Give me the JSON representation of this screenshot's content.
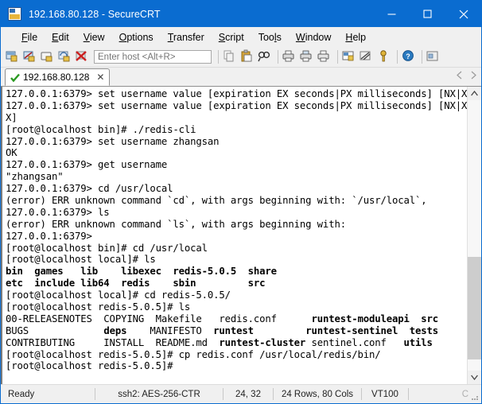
{
  "window": {
    "title": "192.168.80.128 - SecureCRT",
    "app_icon": "terminal-window-icon",
    "minimize_label": "Minimize",
    "maximize_label": "Maximize",
    "close_label": "Close",
    "accent_color": "#0a6cd0",
    "titlebar_text_color": "#ffffff"
  },
  "menubar": {
    "items": [
      {
        "label": "File",
        "mnemonic": "F"
      },
      {
        "label": "Edit",
        "mnemonic": "E"
      },
      {
        "label": "View",
        "mnemonic": "V"
      },
      {
        "label": "Options",
        "mnemonic": "O"
      },
      {
        "label": "Transfer",
        "mnemonic": "T"
      },
      {
        "label": "Script",
        "mnemonic": "S"
      },
      {
        "label": "Tools",
        "mnemonic": "l"
      },
      {
        "label": "Window",
        "mnemonic": "W"
      },
      {
        "label": "Help",
        "mnemonic": "H"
      }
    ]
  },
  "toolbar": {
    "host_placeholder": "Enter host <Alt+R>",
    "host_value": "",
    "icons_left": [
      "new-session-icon",
      "connect-sftp-icon",
      "connect-folder-icon",
      "reconnect-icon",
      "disconnect-icon"
    ],
    "icons_right": [
      "copy-icon",
      "paste-icon",
      "find-icon",
      "print-icon",
      "print-selection-icon",
      "print-screen-icon",
      "session-options-icon",
      "session-settings-icon",
      "key-icon",
      "help-icon",
      "arrange-icon"
    ]
  },
  "tabs": {
    "items": [
      {
        "label": "192.168.80.128",
        "status_icon": "green-check-icon",
        "close_icon": "close-icon",
        "active": true
      }
    ],
    "nav_prev_icon": "nav-prev-icon",
    "nav_next_icon": "nav-next-icon"
  },
  "terminal": {
    "foreground": "#000000",
    "background": "#ffffff",
    "lines": [
      [
        {
          "t": "127.0.0.1:6379> set username value [expiration EX seconds|PX milliseconds] [NX|X",
          "b": false
        }
      ],
      [
        {
          "t": "127.0.0.1:6379> set username value [expiration EX seconds|PX milliseconds] [NX|X",
          "b": false
        }
      ],
      [
        {
          "t": "X]",
          "b": false
        }
      ],
      [
        {
          "t": "[root@localhost bin]# ./redis-cli",
          "b": false
        }
      ],
      [
        {
          "t": "127.0.0.1:6379> set username zhangsan",
          "b": false
        }
      ],
      [
        {
          "t": "OK",
          "b": false
        }
      ],
      [
        {
          "t": "127.0.0.1:6379> get username",
          "b": false
        }
      ],
      [
        {
          "t": "\"zhangsan\"",
          "b": false
        }
      ],
      [
        {
          "t": "127.0.0.1:6379> cd /usr/local",
          "b": false
        }
      ],
      [
        {
          "t": "(error) ERR unknown command `cd`, with args beginning with: `/usr/local`,",
          "b": false
        }
      ],
      [
        {
          "t": "127.0.0.1:6379> ls",
          "b": false
        }
      ],
      [
        {
          "t": "(error) ERR unknown command `ls`, with args beginning with:",
          "b": false
        }
      ],
      [
        {
          "t": "127.0.0.1:6379>",
          "b": false
        }
      ],
      [
        {
          "t": "[root@localhost bin]# cd /usr/local",
          "b": false
        }
      ],
      [
        {
          "t": "[root@localhost local]# ls",
          "b": false
        }
      ],
      [
        {
          "t": "bin  games   lib    libexec  redis-5.0.5  share",
          "b": true
        }
      ],
      [
        {
          "t": "etc  include lib64  redis    sbin         src",
          "b": true
        }
      ],
      [
        {
          "t": "[root@localhost local]# cd redis-5.0.5/",
          "b": false
        }
      ],
      [
        {
          "t": "[root@localhost redis-5.0.5]# ls",
          "b": false
        }
      ],
      [
        {
          "t": "00-RELEASENOTES  COPYING  Makefile   redis.conf      ",
          "b": false
        },
        {
          "t": "runtest-moduleapi  src",
          "b": true
        }
      ],
      [
        {
          "t": "BUGS             ",
          "b": false
        },
        {
          "t": "deps",
          "b": true
        },
        {
          "t": "    MANIFESTO  ",
          "b": false
        },
        {
          "t": "runtest",
          "b": true
        },
        {
          "t": "         runtest-sentinel  tests",
          "b": true
        }
      ],
      [
        {
          "t": "CONTRIBUTING     INSTALL  README.md  ",
          "b": false
        },
        {
          "t": "runtest-cluster",
          "b": true
        },
        {
          "t": " sentinel.conf   ",
          "b": false
        },
        {
          "t": "utils",
          "b": true
        }
      ],
      [
        {
          "t": "[root@localhost redis-5.0.5]# cp redis.conf /usr/local/redis/bin/",
          "b": false
        }
      ],
      [
        {
          "t": "[root@localhost redis-5.0.5]#",
          "b": false
        }
      ]
    ],
    "scrollbar": {
      "up_arrow_icon": "scroll-up-icon",
      "down_arrow_icon": "scroll-down-icon"
    }
  },
  "statusbar": {
    "status": "Ready",
    "encryption": "ssh2: AES-256-CTR",
    "cursor_position": "24, 32",
    "dimensions": "24 Rows, 80 Cols",
    "emulation": "VT100",
    "capture_indicator": "C",
    "resize_grip_icon": "resize-grip-icon"
  }
}
